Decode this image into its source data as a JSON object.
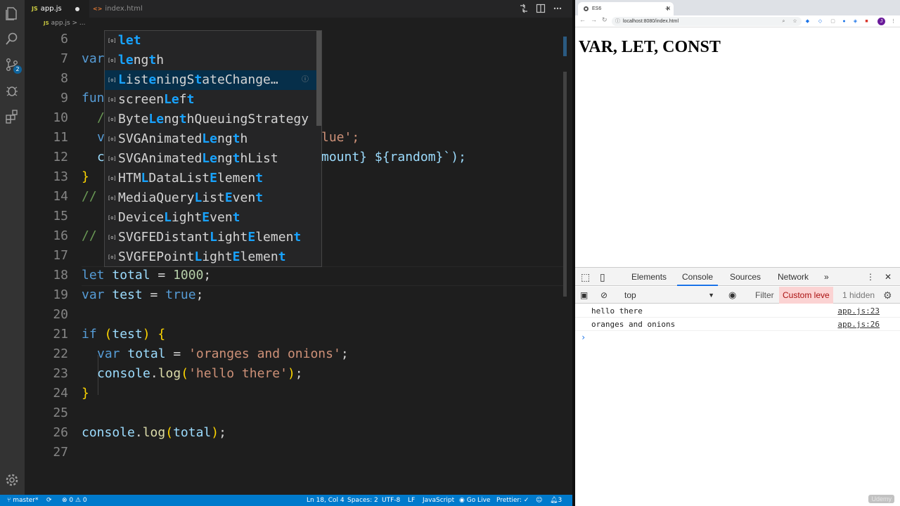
{
  "editor": {
    "tabs": [
      {
        "icon": "JS",
        "label": "app.js",
        "modified": true
      },
      {
        "icon": "<>",
        "label": "index.html",
        "modified": false
      }
    ],
    "breadcrumb": {
      "file": "app.js",
      "sep": "> ..."
    },
    "lines": [
      {
        "n": "6",
        "code": ""
      },
      {
        "n": "7",
        "code": "var"
      },
      {
        "n": "8",
        "code": ""
      },
      {
        "n": "9",
        "code": "fun"
      },
      {
        "n": "10",
        "code": "/"
      },
      {
        "n": "11",
        "code": "v",
        "tail": "lue';"
      },
      {
        "n": "12",
        "code": "c",
        "tail": "mount} ${random}`);"
      },
      {
        "n": "13",
        "code": "}"
      },
      {
        "n": "14",
        "code": "//"
      },
      {
        "n": "15",
        "code": ""
      },
      {
        "n": "16",
        "code": "//"
      },
      {
        "n": "17",
        "code": ""
      },
      {
        "n": "18",
        "code": "let total = 1000;"
      },
      {
        "n": "19",
        "code": "var test = true;"
      },
      {
        "n": "20",
        "code": ""
      },
      {
        "n": "21",
        "code": "if (test) {"
      },
      {
        "n": "22",
        "code": "var total = 'oranges and onions';"
      },
      {
        "n": "23",
        "code": "console.log('hello there');"
      },
      {
        "n": "24",
        "code": "}"
      },
      {
        "n": "25",
        "code": ""
      },
      {
        "n": "26",
        "code": "console.log(total);"
      },
      {
        "n": "27",
        "code": ""
      }
    ],
    "suggestions": [
      "let",
      "length",
      "ListeningStateChange…",
      "screenLeft",
      "ByteLengthQueuingStrategy",
      "SVGAnimatedLength",
      "SVGAnimatedLengthList",
      "HTMLDataListElement",
      "MediaQueryListEvent",
      "DeviceLightEvent",
      "SVGFEDistantLightElement",
      "SVGFEPointLightElement"
    ],
    "selected_suggestion": 2,
    "status": {
      "branch": "master*",
      "problems": "⊗ 0 ⚠ 0",
      "position": "Ln 18, Col 4",
      "spaces": "Spaces: 2",
      "encoding": "UTF-8",
      "eol": "LF",
      "language": "JavaScript",
      "golive": "Go Live",
      "prettier": "Prettier: ✓",
      "bell_count": "3"
    },
    "activity_badges": {
      "scm": "2"
    }
  },
  "browser": {
    "tab_title": "ES6",
    "new_tab": "+",
    "url": "localhost:8080/index.html",
    "avatar": "J",
    "page_heading": "VAR, LET, CONST",
    "devtools": {
      "tabs": [
        "Elements",
        "Console",
        "Sources",
        "Network",
        "»"
      ],
      "active_tab": "Console",
      "context": "top",
      "filter_placeholder": "Filter",
      "levels": "Custom leve",
      "hidden": "1 hidden",
      "messages": [
        {
          "text": "hello there",
          "source": "app.js:23"
        },
        {
          "text": "oranges and onions",
          "source": "app.js:26"
        }
      ],
      "prompt": "›"
    }
  },
  "watermark": "Udemy",
  "colors": {
    "accent": "#007acc",
    "match": "#18a3ff",
    "selection": "#062f4a"
  }
}
